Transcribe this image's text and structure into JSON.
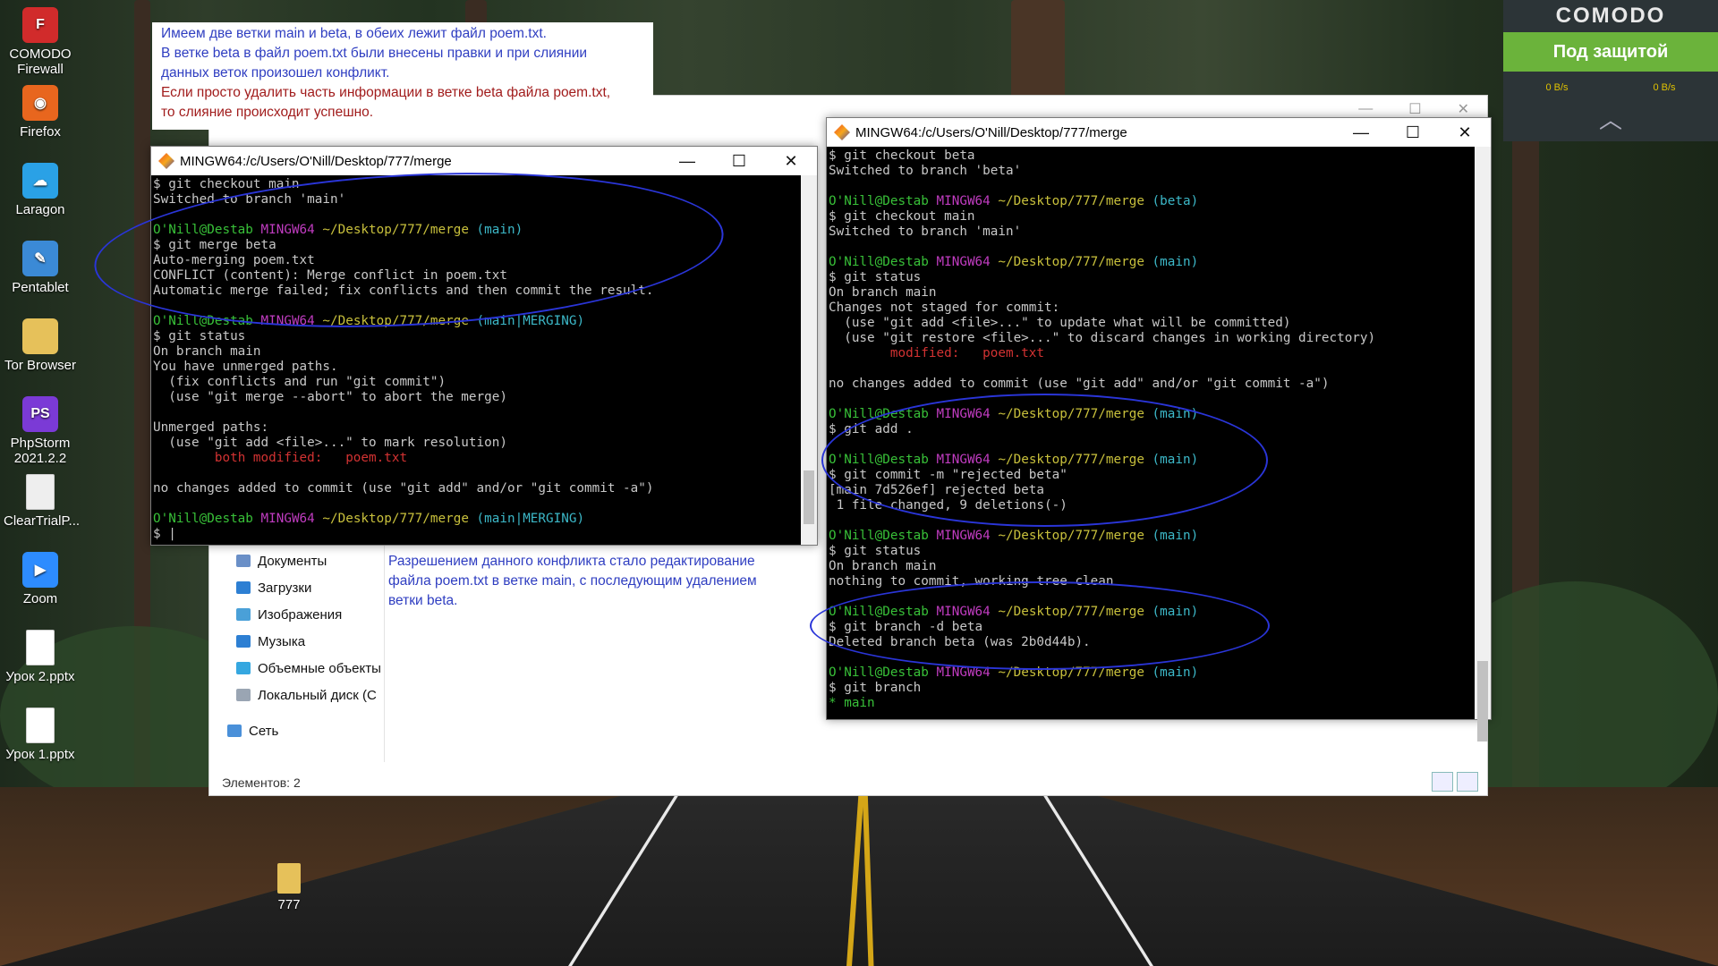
{
  "desktop_icons": [
    {
      "label": "COMODO\nFirewall",
      "icon": "comodo-firewall-icon",
      "color": "#d12b2b",
      "glyph": "F"
    },
    {
      "label": "Firefox",
      "icon": "firefox-icon",
      "color": "#e8661e",
      "glyph": "◉"
    },
    {
      "label": "Laragon",
      "icon": "laragon-icon",
      "color": "#2aa1e6",
      "glyph": "☁"
    },
    {
      "label": "Pentablet",
      "icon": "pentablet-icon",
      "color": "#3b8ad6",
      "glyph": "✎"
    },
    {
      "label": "Tor Browser",
      "icon": "folder-icon",
      "color": "#e6c15a",
      "glyph": ""
    },
    {
      "label": "PhpStorm\n2021.2.2",
      "icon": "phpstorm-icon",
      "color": "#7b3ad6",
      "glyph": "PS"
    },
    {
      "label": "ClearTrialP...",
      "icon": "document-icon",
      "color": "#eeeeee",
      "glyph": ""
    },
    {
      "label": "Zoom",
      "icon": "zoom-icon",
      "color": "#2d8cff",
      "glyph": "▶"
    },
    {
      "label": "Урок 2.pptx",
      "icon": "document-icon",
      "color": "#ffffff",
      "glyph": ""
    },
    {
      "label": "Урок 1.pptx",
      "icon": "document-icon",
      "color": "#ffffff",
      "glyph": ""
    }
  ],
  "folder_777": {
    "label": "777"
  },
  "comodo": {
    "brand": "COMODO",
    "status": "Под защитой",
    "rate_left": "0 B/s",
    "rate_right": "0 B/s",
    "chevron": "︿"
  },
  "note": {
    "line1": "Имеем две ветки main и beta, в обеих лежит файл poem.txt.",
    "line2": "В ветке beta в файл poem.txt были внесены правки и при слиянии",
    "line3": "данных веток произошел конфликт.",
    "line4": "Если просто удалить часть информации в ветке beta файла poem.txt,",
    "line5": "то слияние происходит успешно."
  },
  "explorer": {
    "sidebar": [
      {
        "label": "Документы",
        "icon": "documents-icon"
      },
      {
        "label": "Загрузки",
        "icon": "downloads-icon"
      },
      {
        "label": "Изображения",
        "icon": "images-icon"
      },
      {
        "label": "Музыка",
        "icon": "music-icon"
      },
      {
        "label": "Объемные объекты",
        "icon": "3d-objects-icon"
      },
      {
        "label": "Локальный диск (C",
        "icon": "disk-icon"
      },
      {
        "label": "Сеть",
        "icon": "network-icon"
      }
    ],
    "note": "Разрешением данного конфликта стало редактирование файла poem.txt в ветке main, с последующим удалением ветки beta.",
    "status": "Элементов: 2"
  },
  "term_left": {
    "title": "MINGW64:/c/Users/O'Nill/Desktop/777/merge",
    "controls": [
      "—",
      "☐",
      "✕"
    ]
  },
  "term_right": {
    "title": "MINGW64:/c/Users/O'Nill/Desktop/777/merge",
    "controls": [
      "—",
      "☐",
      "✕"
    ]
  },
  "colors": {
    "prompt_user": "#38c038",
    "prompt_host": "#c03cc0",
    "prompt_path": "#c8c03c",
    "prompt_branch": "#3cb8c8",
    "error": "#d23232",
    "annotation": "#2a35d8"
  }
}
